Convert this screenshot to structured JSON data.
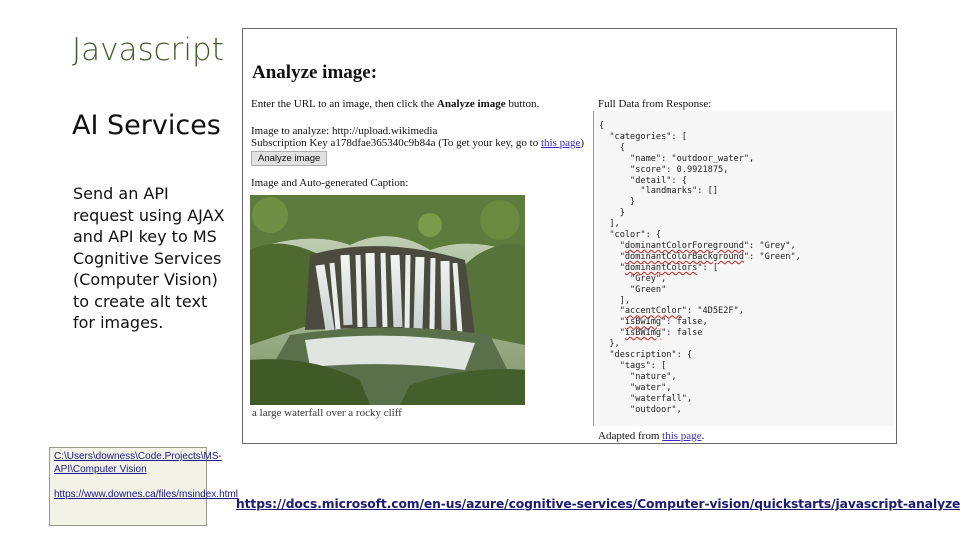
{
  "slide": {
    "title": "Javascript",
    "subtitle": "AI Services",
    "body": "Send an API request using AJAX and API key to MS Cognitive Services (Computer Vision) to create alt text for images.",
    "links": [
      "C:\\Users\\downess\\Code.Projects\\MS-API\\Computer Vision",
      "https://www.downes.ca/files/msindex.html"
    ],
    "footer_url": "https://docs.microsoft.com/en-us/azure/cognitive-services/Computer-vision/quickstarts/javascript-analyze"
  },
  "demo": {
    "heading": "Analyze image:",
    "instructions_pre": "Enter the URL to an image, then click the ",
    "instructions_bold": "Analyze image",
    "instructions_post": " button.",
    "image_label": "Image to analyze: ",
    "image_value": "http://upload.wikimedia",
    "key_label": "Subscription Key ",
    "key_value": "a178dfae365340c9b84a",
    "key_hint_pre": " (To get your key, go to ",
    "key_hint_link": "this page",
    "key_hint_post": ")",
    "button_label": "Analyze image",
    "caption_label": "Image and Auto-generated Caption:",
    "image_caption": "a large waterfall over a rocky cliff",
    "json_title": "Full Data from Response:",
    "adapted_pre": "Adapted from ",
    "adapted_link": "this page",
    "adapted_post": "."
  },
  "json": {
    "l01": "{",
    "l02": "  \"categories\": [",
    "l03": "    {",
    "l04": "      \"name\": \"outdoor_water\",",
    "l05": "      \"score\": 0.9921875,",
    "l06": "      \"detail\": {",
    "l07": "        \"landmarks\": []",
    "l08": "      }",
    "l09": "    }",
    "l10": "  ],",
    "l11": "  \"color\": {",
    "l12a": "    \"",
    "l12b": "dominantColorForeground",
    "l12c": "\": \"Grey\",",
    "l13a": "    \"",
    "l13b": "dominantColorBackground",
    "l13c": "\": \"Green\",",
    "l14a": "    \"",
    "l14b": "dominantColors",
    "l14c": "\": [",
    "l15": "      \"Grey\",",
    "l16": "      \"Green\"",
    "l17": "    ],",
    "l18a": "    \"",
    "l18b": "accentColor",
    "l18c": "\": \"4D5E2F\",",
    "l19a": "    \"",
    "l19b": "isBwImg",
    "l19c": "\": false,",
    "l20a": "    \"",
    "l20b": "isBWImg",
    "l20c": "\": false",
    "l21": "  },",
    "l22": "  \"description\": {",
    "l23": "    \"tags\": [",
    "l24": "      \"nature\",",
    "l25": "      \"water\",",
    "l26": "      \"waterfall\",",
    "l27": "      \"outdoor\","
  },
  "colors": {
    "title_green": "#3e5b25",
    "link_blue": "#1a1a7a",
    "note_bg": "#f2f2e6"
  }
}
